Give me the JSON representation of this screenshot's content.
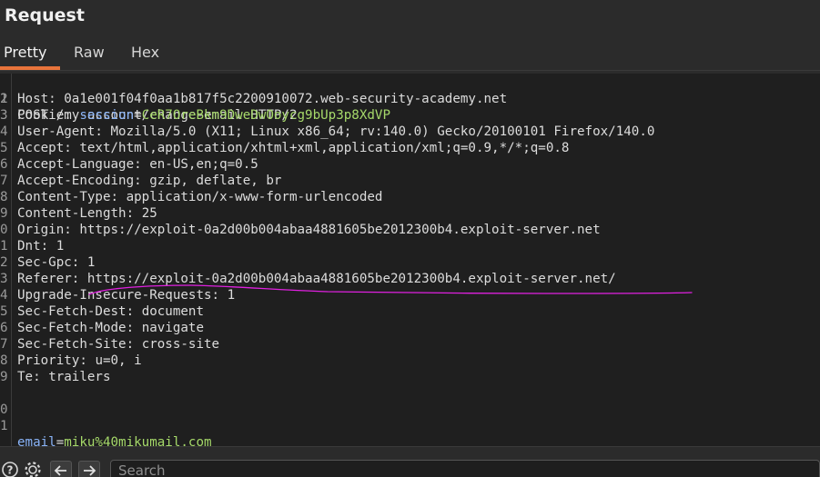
{
  "panel": {
    "title": "Request"
  },
  "tabs": [
    {
      "label": "Pretty",
      "active": true
    },
    {
      "label": "Raw",
      "active": false
    },
    {
      "label": "Hex",
      "active": false
    }
  ],
  "request": {
    "request_line": "POST /my-account/change-email HTTP/2",
    "headers": [
      {
        "name": "Host",
        "value": "0a1e001f04f0aa1b817f5c2200910072.web-security-academy.net"
      },
      {
        "name": "Cookie",
        "value": "session=CeR7OreBkm9DweDwOoycg9bUp3p8XdVP",
        "cookie_name": "session",
        "cookie_value": "CeR7OreBkm9DweDwOoycg9bUp3p8XdVP"
      },
      {
        "name": "User-Agent",
        "value": "Mozilla/5.0 (X11; Linux x86_64; rv:140.0) Gecko/20100101 Firefox/140.0"
      },
      {
        "name": "Accept",
        "value": "text/html,application/xhtml+xml,application/xml;q=0.9,*/*;q=0.8"
      },
      {
        "name": "Accept-Language",
        "value": "en-US,en;q=0.5"
      },
      {
        "name": "Accept-Encoding",
        "value": "gzip, deflate, br"
      },
      {
        "name": "Content-Type",
        "value": "application/x-www-form-urlencoded"
      },
      {
        "name": "Content-Length",
        "value": "25"
      },
      {
        "name": "Origin",
        "value": "https://exploit-0a2d00b004abaa4881605be2012300b4.exploit-server.net"
      },
      {
        "name": "Dnt",
        "value": "1"
      },
      {
        "name": "Sec-Gpc",
        "value": "1"
      },
      {
        "name": "Referer",
        "value": "https://exploit-0a2d00b004abaa4881605be2012300b4.exploit-server.net/"
      },
      {
        "name": "Upgrade-Insecure-Requests",
        "value": "1"
      },
      {
        "name": "Sec-Fetch-Dest",
        "value": "document"
      },
      {
        "name": "Sec-Fetch-Mode",
        "value": "navigate"
      },
      {
        "name": "Sec-Fetch-Site",
        "value": "cross-site"
      },
      {
        "name": "Priority",
        "value": "u=0, i"
      },
      {
        "name": "Te",
        "value": "trailers"
      }
    ],
    "body": {
      "param_name": "email",
      "param_value": "miku%40mikumail.com"
    }
  },
  "line_numbers": [
    "1",
    "2",
    "3",
    "4",
    "5",
    "6",
    "7",
    "8",
    "9",
    "0",
    "1",
    "2",
    "3",
    "4",
    "5",
    "6",
    "7",
    "8",
    "9",
    "0",
    "1"
  ],
  "footer": {
    "help_icon": "question-circle-icon",
    "settings_icon": "gear-icon",
    "back_icon": "arrow-left-icon",
    "forward_icon": "arrow-right-icon",
    "search_placeholder": "Search"
  },
  "colors": {
    "accent_tab": "#e8743b",
    "annotation_stroke": "#e020e0",
    "param_name": "#8ab4f8",
    "param_value": "#a6d96a"
  }
}
